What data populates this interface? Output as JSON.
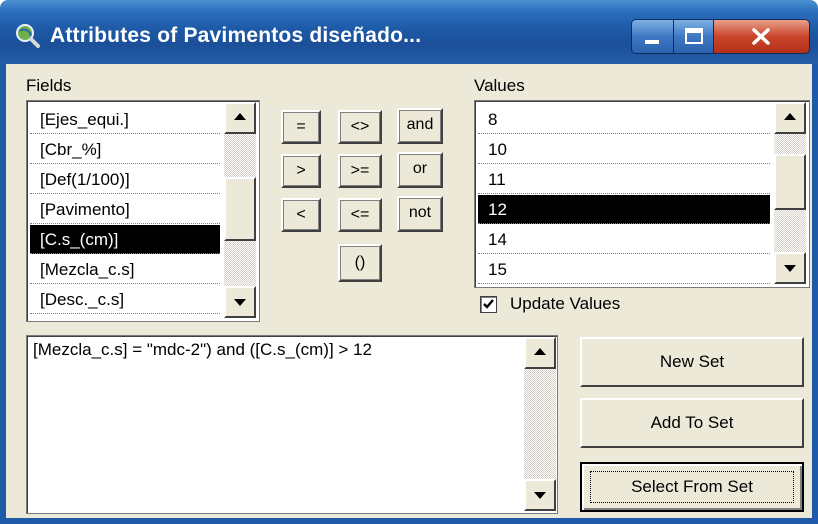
{
  "window": {
    "title": "Attributes of Pavimentos diseñado...",
    "icon": "magnifier-globe-icon",
    "controls": {
      "minimize": "minimize-icon",
      "maximize": "maximize-icon",
      "close": "close-icon"
    }
  },
  "fields": {
    "label": "Fields",
    "items": [
      "[Ejes_equi.]",
      "[Cbr_%]",
      "[Def(1/100)]",
      "[Pavimento]",
      "[C.s_(cm)]",
      "[Mezcla_c.s]",
      "[Desc._c.s]"
    ],
    "selected": "[C.s_(cm)]"
  },
  "operators": {
    "equals": "=",
    "not_equals": "<>",
    "and": "and",
    "greater": ">",
    "greater_equal": ">=",
    "or": "or",
    "less": "<",
    "less_equal": "<=",
    "not": "not",
    "parens": "()"
  },
  "values": {
    "label": "Values",
    "items": [
      "8",
      "10",
      "11",
      "12",
      "14",
      "15"
    ],
    "selected": "12",
    "update_label": "Update Values",
    "update_checked": true
  },
  "expression": {
    "text": "[Mezcla_c.s] = \"mdc-2\") and ([C.s_(cm)] > 12"
  },
  "actions": {
    "new_set": "New Set",
    "add_to_set": "Add To Set",
    "select_from_set": "Select From Set"
  },
  "colors": {
    "titlebar": "#1d5aa8",
    "face": "#ece9d8",
    "selection": "#000000",
    "close": "#c9462a"
  }
}
